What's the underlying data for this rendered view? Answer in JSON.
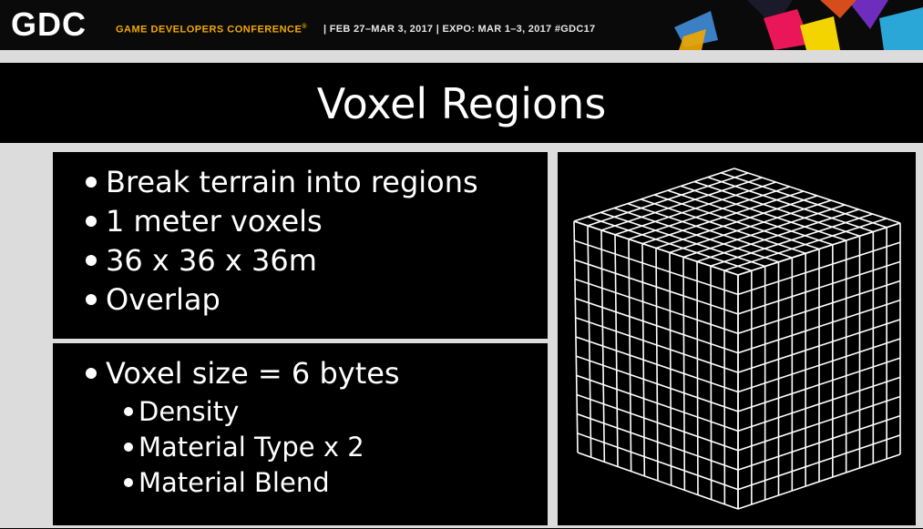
{
  "header": {
    "logo": "GDC",
    "conference": "GAME DEVELOPERS CONFERENCE",
    "registered_mark": "®",
    "dates": "| FEB 27–MAR 3, 2017 | EXPO: MAR 1–3, 2017 #GDC17"
  },
  "slide": {
    "title": "Voxel Regions",
    "panel_top": [
      "Break terrain into regions",
      "1 meter voxels",
      "36 x 36 x 36m",
      "Overlap"
    ],
    "panel_bottom": {
      "main": "Voxel size = 6 bytes",
      "sub": [
        "Density",
        "Material Type x 2",
        "Material Blend"
      ]
    },
    "illustration": "voxel-grid-cube"
  },
  "colors": {
    "accent": "#f2a900",
    "background": "#dcdcdc",
    "panel": "#000000",
    "text": "#ffffff"
  }
}
